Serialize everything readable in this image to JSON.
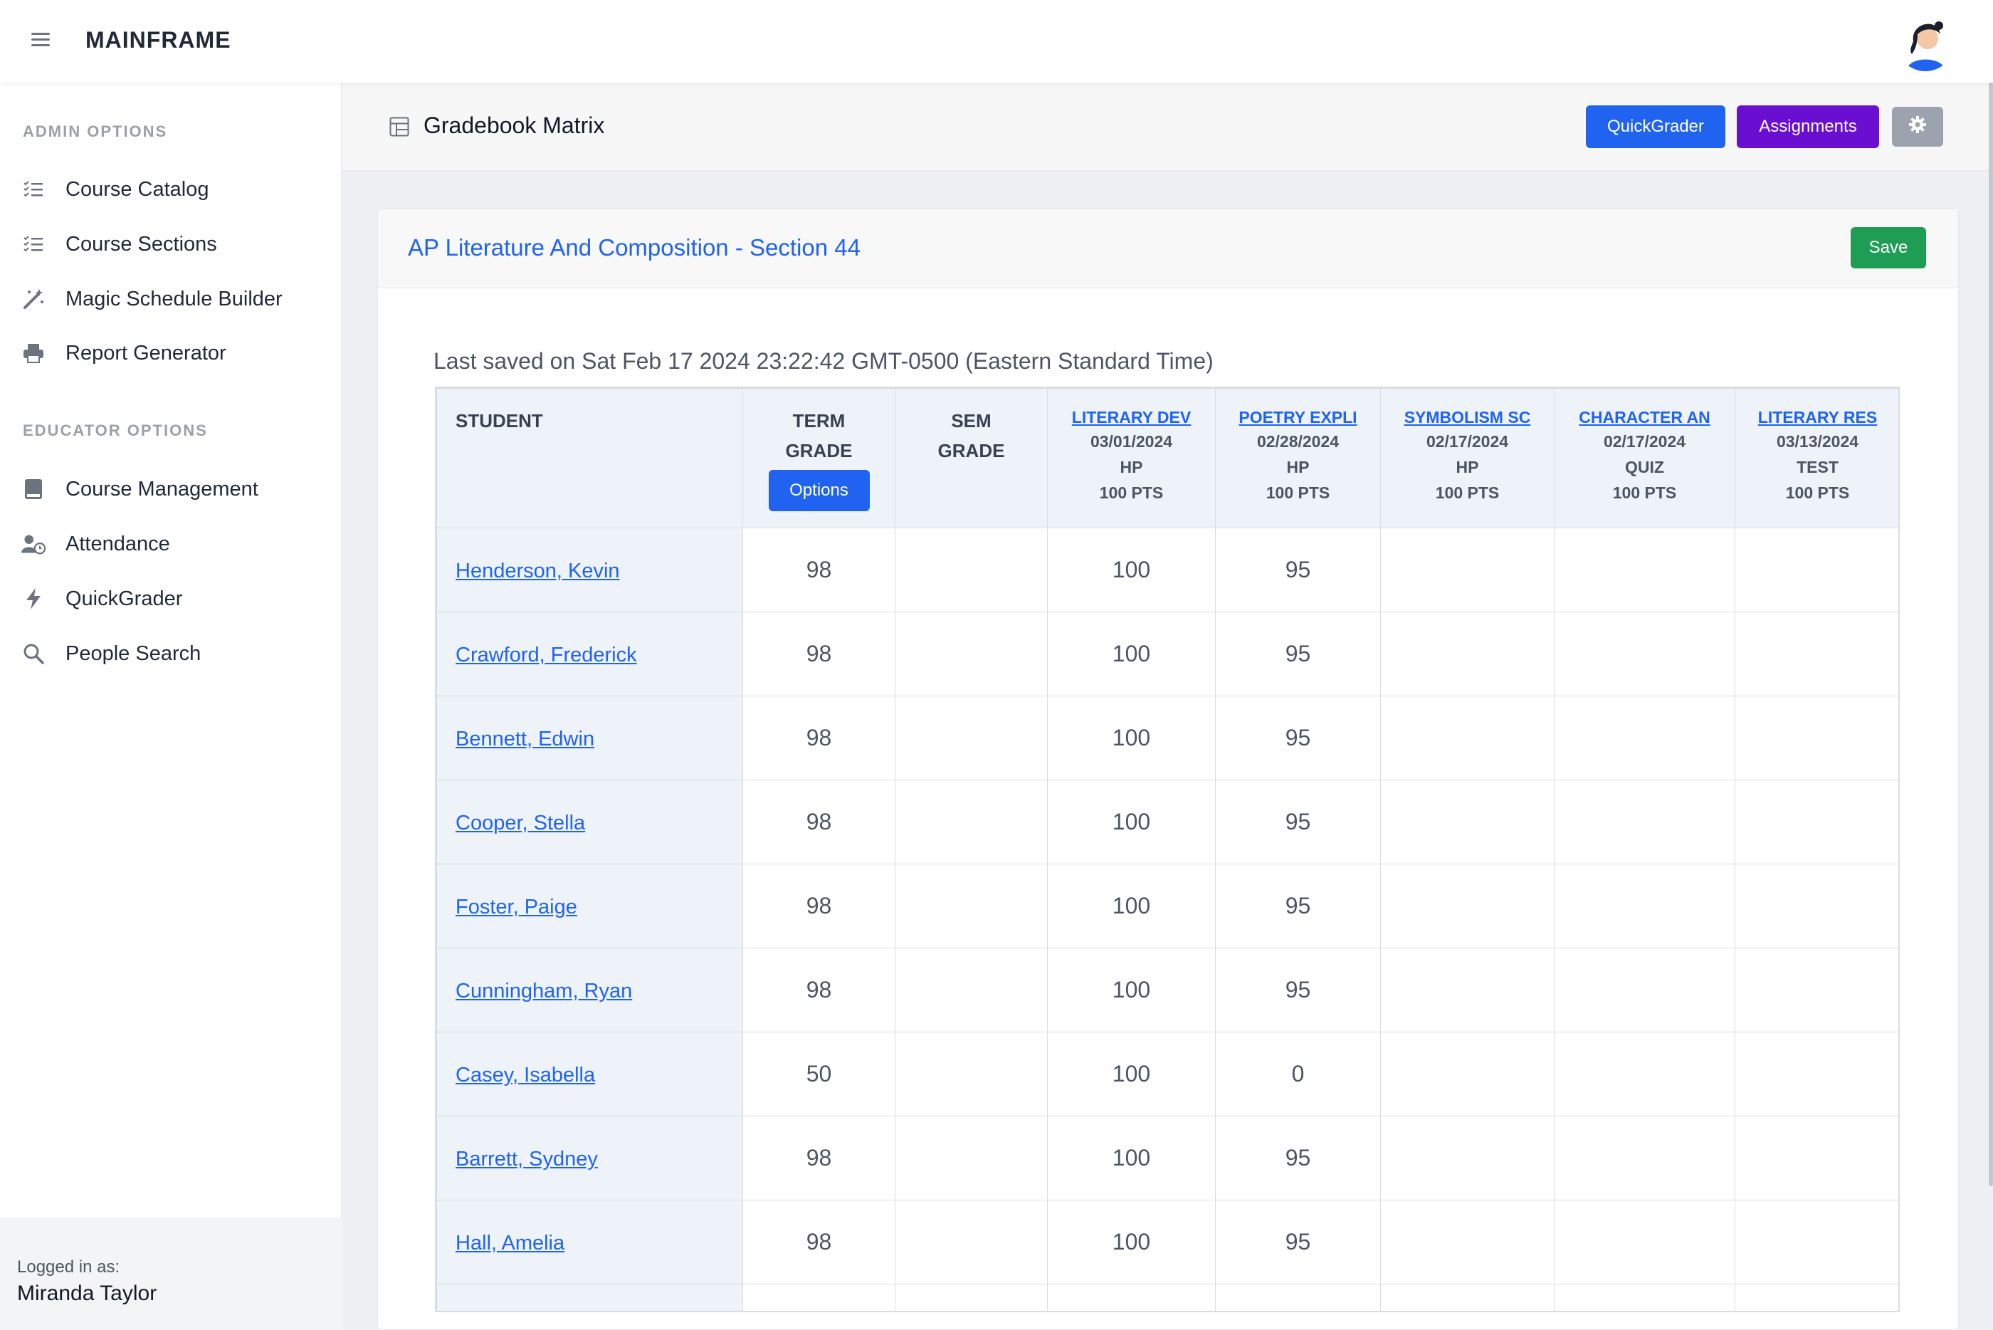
{
  "topbar": {
    "brand": "MAINFRAME",
    "menu_icon": "hamburger-icon",
    "avatar": "user-avatar"
  },
  "sidebar": {
    "admin_heading": "ADMIN OPTIONS",
    "admin_items": [
      {
        "label": "Course Catalog",
        "icon": "checklist-icon"
      },
      {
        "label": "Course Sections",
        "icon": "checklist-icon"
      },
      {
        "label": "Magic Schedule Builder",
        "icon": "magic-wand-icon"
      },
      {
        "label": "Report Generator",
        "icon": "printer-icon"
      }
    ],
    "educator_heading": "EDUCATOR OPTIONS",
    "educator_items": [
      {
        "label": "Course Management",
        "icon": "book-icon"
      },
      {
        "label": "Attendance",
        "icon": "user-clock-icon"
      },
      {
        "label": "QuickGrader",
        "icon": "lightning-icon"
      },
      {
        "label": "People Search",
        "icon": "search-icon"
      }
    ],
    "logged_in_label": "Logged in as:",
    "user_name": "Miranda Taylor"
  },
  "page": {
    "title": "Gradebook Matrix",
    "title_icon": "table-icon",
    "quickgrader_label": "QuickGrader",
    "assignments_label": "Assignments",
    "settings_icon": "gear-icon"
  },
  "card": {
    "title": "AP Literature And Composition - Section 44",
    "save_label": "Save",
    "last_saved": "Last saved on Sat Feb 17 2024 23:22:42 GMT-0500 (Eastern Standard Time)"
  },
  "table": {
    "student_header": "STUDENT",
    "term_header": [
      "TERM",
      "GRADE"
    ],
    "options_label": "Options",
    "sem_header": [
      "SEM",
      "GRADE"
    ],
    "assignments": [
      {
        "title": "LITERARY DEV",
        "date": "03/01/2024",
        "type": "HP",
        "points": "100 PTS"
      },
      {
        "title": "POETRY EXPLI",
        "date": "02/28/2024",
        "type": "HP",
        "points": "100 PTS"
      },
      {
        "title": "SYMBOLISM SC",
        "date": "02/17/2024",
        "type": "HP",
        "points": "100 PTS"
      },
      {
        "title": "CHARACTER AN",
        "date": "02/17/2024",
        "type": "QUIZ",
        "points": "100 PTS"
      },
      {
        "title": "LITERARY RES",
        "date": "03/13/2024",
        "type": "TEST",
        "points": "100 PTS"
      }
    ],
    "rows": [
      {
        "name": "Henderson, Kevin",
        "term": "98",
        "sem": "",
        "scores": [
          "100",
          "95",
          "",
          "",
          ""
        ]
      },
      {
        "name": "Crawford, Frederick",
        "term": "98",
        "sem": "",
        "scores": [
          "100",
          "95",
          "",
          "",
          ""
        ]
      },
      {
        "name": "Bennett, Edwin",
        "term": "98",
        "sem": "",
        "scores": [
          "100",
          "95",
          "",
          "",
          ""
        ]
      },
      {
        "name": "Cooper, Stella",
        "term": "98",
        "sem": "",
        "scores": [
          "100",
          "95",
          "",
          "",
          ""
        ]
      },
      {
        "name": "Foster, Paige",
        "term": "98",
        "sem": "",
        "scores": [
          "100",
          "95",
          "",
          "",
          ""
        ]
      },
      {
        "name": "Cunningham, Ryan",
        "term": "98",
        "sem": "",
        "scores": [
          "100",
          "95",
          "",
          "",
          ""
        ]
      },
      {
        "name": "Casey, Isabella",
        "term": "50",
        "sem": "",
        "scores": [
          "100",
          "0",
          "",
          "",
          ""
        ]
      },
      {
        "name": "Barrett, Sydney",
        "term": "98",
        "sem": "",
        "scores": [
          "100",
          "95",
          "",
          "",
          ""
        ]
      },
      {
        "name": "Hall, Amelia",
        "term": "98",
        "sem": "",
        "scores": [
          "100",
          "95",
          "",
          "",
          ""
        ]
      },
      {
        "name": "",
        "term": "",
        "sem": "",
        "scores": [
          "",
          "",
          "",
          "",
          ""
        ]
      }
    ]
  },
  "colors": {
    "primary": "#1f63f0",
    "purple": "#6a0fd1",
    "success": "#1f9d55",
    "gray_button": "#9ca3af"
  }
}
